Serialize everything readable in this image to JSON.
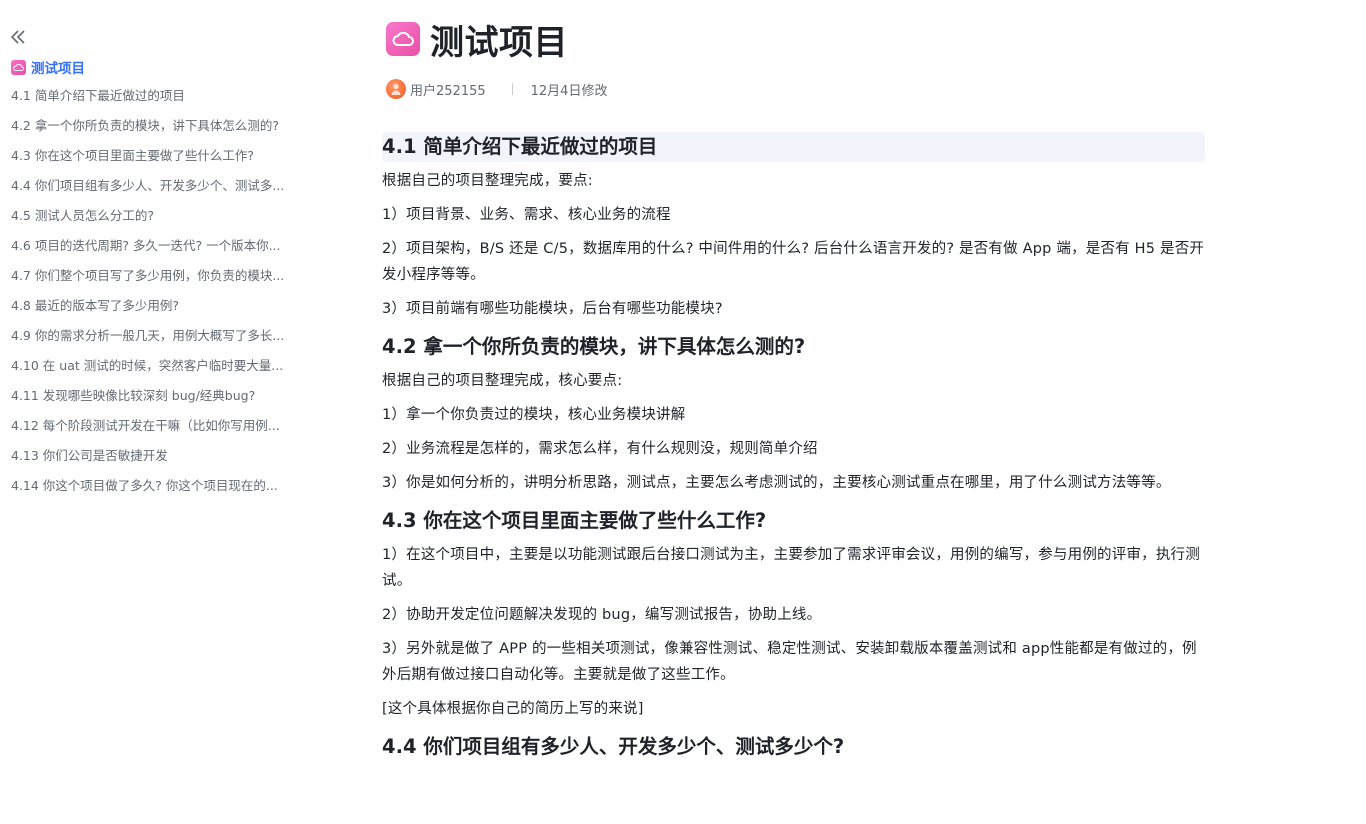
{
  "doc": {
    "title": "测试项目",
    "author": "用户252155",
    "modified": "12月4日修改"
  },
  "toc": {
    "title": "测试项目",
    "items": [
      "4.1 简单介绍下最近做过的项目",
      "4.2 拿一个你所负责的模块，讲下具体怎么测的?",
      "4.3 你在这个项目里面主要做了些什么工作?",
      "4.4 你们项目组有多少人、开发多少个、测试多...",
      "4.5 测试人员怎么分工的?",
      "4.6 项目的迭代周期? 多久一迭代? 一个版本你...",
      "4.7 你们整个项目写了多少用例，你负责的模块...",
      "4.8 最近的版本写了多少用例?",
      "4.9 你的需求分析一般几天，用例大概写了多长...",
      "4.10 在 uat 测试的时候，突然客户临时要大量...",
      "4.11 发现哪些映像比较深刻 bug/经典bug?",
      "4.12 每个阶段测试开发在干嘛（比如你写用例...",
      "4.13 你们公司是否敏捷开发",
      "4.14 你这个项目做了多久? 你这个项目现在的..."
    ]
  },
  "sections": [
    {
      "heading": "4.1 简单介绍下最近做过的项目",
      "paragraphs": [
        "根据自己的项目整理完成，要点:",
        "1）项目背景、业务、需求、核心业务的流程",
        "2）项目架构，B/S 还是 C/5，数据库用的什么? 中间件用的什么? 后台什么语言开发的? 是否有做 App 端，是否有 H5 是否开发小程序等等。",
        "3）项目前端有哪些功能模块，后台有哪些功能模块?"
      ]
    },
    {
      "heading": "4.2 拿一个你所负责的模块，讲下具体怎么测的?",
      "paragraphs": [
        "根据自己的项目整理完成，核心要点:",
        "1）拿一个你负责过的模块，核心业务模块讲解",
        "2）业务流程是怎样的，需求怎么样，有什么规则没，规则简单介绍",
        "3）你是如何分析的，讲明分析思路，测试点，主要怎么考虑测试的，主要核心测试重点在哪里，用了什么测试方法等等。"
      ]
    },
    {
      "heading": "4.3 你在这个项目里面主要做了些什么工作?",
      "paragraphs": [
        "1）在这个项目中，主要是以功能测试跟后台接口测试为主，主要参加了需求评审会议，用例的编写，参与用例的评审，执行测试。",
        "2）协助开发定位问题解决发现的 bug，编写测试报告，协助上线。",
        "3）另外就是做了 APP 的一些相关项测试，像兼容性测试、稳定性测试、安装卸载版本覆盖测试和 app性能都是有做过的，例外后期有做过接口自动化等。主要就是做了这些工作。",
        "[这个具体根据你自己的简历上写的来说]"
      ]
    },
    {
      "heading": "4.4 你们项目组有多少人、开发多少个、测试多少个?",
      "paragraphs": []
    }
  ]
}
